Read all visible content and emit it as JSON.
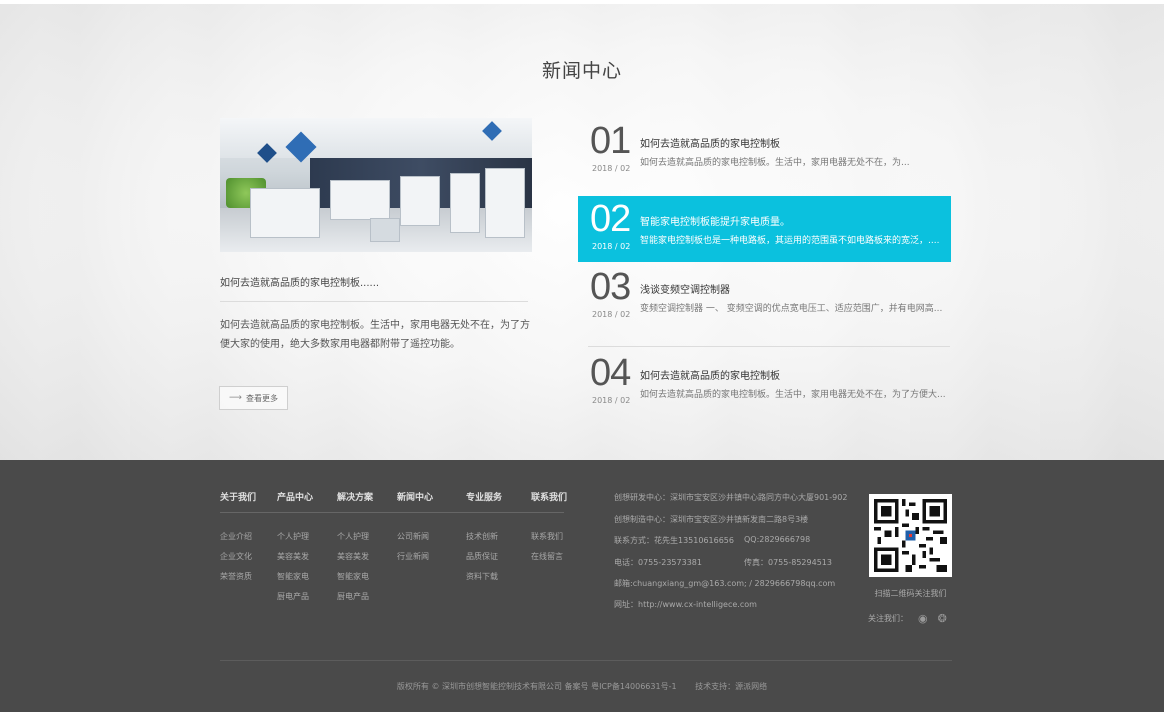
{
  "news_section": {
    "title": "新闻中心",
    "feature": {
      "headline": "如何去造就高品质的家电控制板......",
      "summary": "如何去造就高品质的家电控制板。生活中，家用电器无处不在，为了方便大家的使用，绝大多数家用电器都附带了遥控功能。",
      "more_label": "查看更多"
    },
    "items": [
      {
        "num": "01",
        "date": "2018 / 02",
        "title": "如何去造就高品质的家电控制板",
        "excerpt": "如何去造就高品质的家电控制板。生活中，家用电器无处不在，为..."
      },
      {
        "num": "02",
        "date": "2018 / 02",
        "title": "智能家电控制板能提升家电质量。",
        "excerpt": "智能家电控制板也是一种电路板，其运用的范围虽不如电路板来的宽泛，...."
      },
      {
        "num": "03",
        "date": "2018 / 02",
        "title": "浅谈变频空调控制器",
        "excerpt": "变频空调控制器 一、 变频空调的优点宽电压工、适应范围广，并有电网高..."
      },
      {
        "num": "04",
        "date": "2018 / 02",
        "title": "如何去造就高品质的家电控制板",
        "excerpt": "如何去造就高品质的家电控制板。生活中，家用电器无处不在，为了方便大..."
      }
    ],
    "active_color": "#0bc1de"
  },
  "footer": {
    "nav": [
      {
        "head": "关于我们",
        "links": [
          "企业介绍",
          "企业文化",
          "荣誉资质"
        ]
      },
      {
        "head": "产品中心",
        "links": [
          "个人护理",
          "美容美发",
          "智能家电",
          "厨电产品"
        ]
      },
      {
        "head": "解决方案",
        "links": [
          "个人护理",
          "美容美发",
          "智能家电",
          "厨电产品"
        ]
      },
      {
        "head": "新闻中心",
        "links": [
          "公司新闻",
          "行业新闻"
        ]
      },
      {
        "head": "专业服务",
        "links": [
          "技术创新",
          "品质保证",
          "资料下载"
        ]
      },
      {
        "head": "联系我们",
        "links": [
          "联系我们",
          "在线留言"
        ]
      }
    ],
    "contact": {
      "rd_center": "创想研发中心：深圳市宝安区沙井镇中心路同方中心大厦901-902",
      "factory": "创想制造中心：深圳市宝安区沙井镇新发南二路8号3楼",
      "contact_person": "联系方式：花先生13510616656",
      "qq": "QQ:2829666798",
      "phone": "电话：0755-23573381",
      "fax": "传真：0755-85294513",
      "email": "邮箱:chuangxiang_gm@163.com;  /  2829666798qq.com",
      "website": "网址：http://www.cx-intelligece.com"
    },
    "qr_caption": "扫描二维码关注我们",
    "follow_label": "关注我们：",
    "social_icons": [
      "weibo-icon",
      "wechat-icon"
    ],
    "copyright": "版权所有 © 深圳市创想智能控制技术有限公司 备案号 粤ICP备14006631号-1",
    "tech_support": "技术支持：源派网络"
  }
}
